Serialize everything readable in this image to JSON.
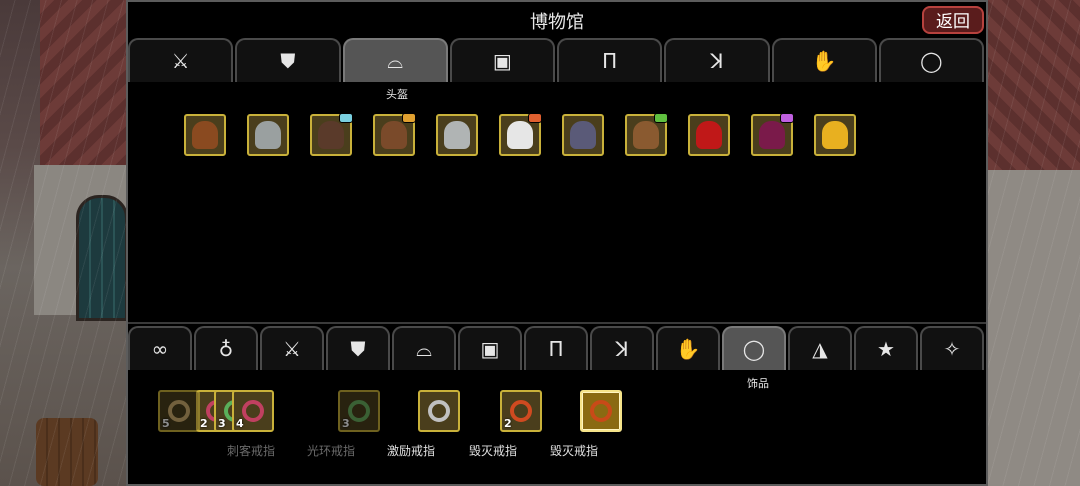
{
  "title": "博物馆",
  "back_label": "返回",
  "top_tabs": {
    "active_caption": "头盔",
    "icons": [
      "sword-icon",
      "shield-icon",
      "helmet-icon",
      "armor-icon",
      "pants-icon",
      "boots-icon",
      "glove-icon",
      "ring-icon"
    ],
    "glyphs": [
      "⚔",
      "⛊",
      "⌓",
      "▣",
      "Π",
      "ꓘ",
      "✋",
      "◯"
    ],
    "active_index": 2
  },
  "helmets": [
    {
      "name": "leather-helmet",
      "color": "#8a4a20",
      "badge": ""
    },
    {
      "name": "iron-mask-helmet",
      "color": "#9aa0a0",
      "badge": ""
    },
    {
      "name": "dark-helmet",
      "color": "#5a3a2a",
      "badge": "#7ad0e0"
    },
    {
      "name": "bronze-helmet",
      "color": "#7a4a2a",
      "badge": "#e0a030"
    },
    {
      "name": "steel-helmet",
      "color": "#b0b4b4",
      "badge": ""
    },
    {
      "name": "white-helmet",
      "color": "#e6e6e6",
      "badge": "#e06030"
    },
    {
      "name": "purple-helmet",
      "color": "#5a5a78",
      "badge": ""
    },
    {
      "name": "barbarian-helmet",
      "color": "#8a5a30",
      "badge": "#60c040"
    },
    {
      "name": "red-helmet",
      "color": "#c01818",
      "badge": ""
    },
    {
      "name": "crimson-hood",
      "color": "#7a1a4a",
      "badge": "#c060e0"
    },
    {
      "name": "golden-helmet",
      "color": "#e8b020",
      "badge": ""
    }
  ],
  "bottom_tabs": {
    "active_caption": "饰品",
    "icons": [
      "infinity-icon",
      "potion-icon",
      "sword-icon",
      "shield-icon",
      "helmet-icon",
      "armor-icon",
      "pants-icon",
      "boots-icon",
      "glove-icon",
      "ring-icon",
      "hat-icon",
      "star-icon",
      "wand-icon"
    ],
    "glyphs": [
      "∞",
      "♁",
      "⚔",
      "⛊",
      "⌓",
      "▣",
      "Π",
      "ꓘ",
      "✋",
      "◯",
      "◮",
      "★",
      "✧"
    ],
    "active_index": 9
  },
  "accessories": [
    {
      "label": "刺客戒指",
      "dim": true,
      "count": "5",
      "ring": "#d0b070",
      "selected": false
    },
    {
      "label": "光环戒指",
      "dim": true,
      "count": "3",
      "ring": "#6ab060",
      "selected": false
    },
    {
      "label": "激励戒指",
      "dim": false,
      "count": "",
      "ring": "#c0c0c0",
      "selected": false
    },
    {
      "label": "毁灭戒指",
      "dim": false,
      "count": "2",
      "ring": "#d04a20",
      "selected": false
    },
    {
      "label": "毁灭戒指",
      "dim": false,
      "count": "",
      "ring": "#c84a18",
      "selected": true
    }
  ],
  "stack_counts": [
    "2",
    "3",
    "4"
  ]
}
